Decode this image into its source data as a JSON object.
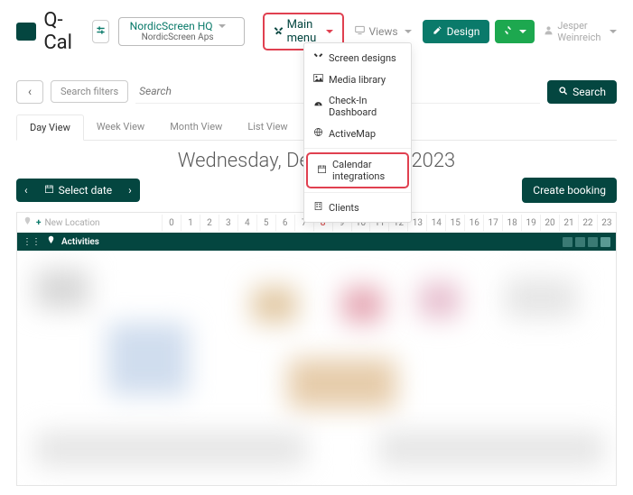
{
  "brand": {
    "name": "Q-Cal"
  },
  "org": {
    "line1": "NordicScreen HQ",
    "line2": "NordicScreen Aps"
  },
  "topbar": {
    "main_menu_label": "Main menu",
    "views_label": "Views",
    "design_label": "Design",
    "user_name": "Jesper Weinreich"
  },
  "menu": {
    "items": [
      {
        "label": "Screen designs"
      },
      {
        "label": "Media library"
      },
      {
        "label": "Check-In Dashboard"
      },
      {
        "label": "ActiveMap"
      },
      {
        "label": "Calendar integrations"
      },
      {
        "label": "Clients"
      }
    ]
  },
  "search": {
    "filters_label": "Search filters",
    "placeholder": "Search",
    "button_label": "Search"
  },
  "tabs": {
    "items": [
      {
        "label": "Day View",
        "active": true
      },
      {
        "label": "Week View"
      },
      {
        "label": "Month View"
      },
      {
        "label": "List View"
      }
    ]
  },
  "date_heading": "Wednesday, December 20, 2023",
  "controls": {
    "select_date_label": "Select date",
    "create_booking_label": "Create booking"
  },
  "timeline": {
    "new_location_label": "New Location",
    "activities_label": "Activities",
    "hours": [
      "0",
      "1",
      "2",
      "3",
      "4",
      "5",
      "6",
      "7",
      "8",
      "9",
      "10",
      "11",
      "12",
      "13",
      "14",
      "15",
      "16",
      "17",
      "18",
      "19",
      "20",
      "21",
      "22",
      "23"
    ],
    "current_hour": "8"
  }
}
